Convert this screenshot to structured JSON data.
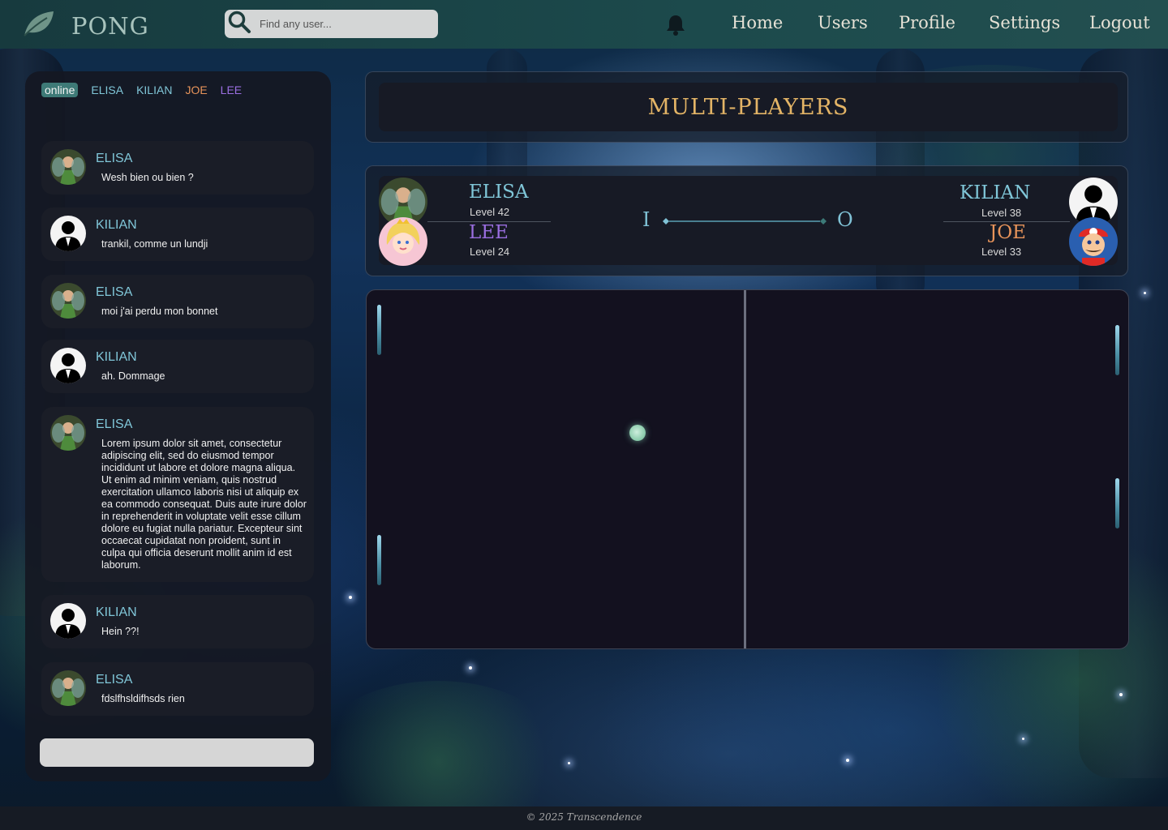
{
  "brand": {
    "name": "PONG"
  },
  "search": {
    "placeholder": "Find any user..."
  },
  "nav": {
    "home": "Home",
    "users": "Users",
    "profile": "Profile",
    "settings": "Settings",
    "logout": "Logout"
  },
  "online": {
    "label": "online",
    "users": [
      {
        "name": "ELISA",
        "color": "#80c6d8"
      },
      {
        "name": "KILIAN",
        "color": "#80c6d8"
      },
      {
        "name": "JOE",
        "color": "#e8945a"
      },
      {
        "name": "LEE",
        "color": "#9a6ee0"
      }
    ]
  },
  "chat": {
    "messages": [
      {
        "author": "ELISA",
        "avatar": "fairy-avatar",
        "text": "Wesh bien ou bien ?"
      },
      {
        "author": "KILIAN",
        "avatar": "silhouette-avatar",
        "text": "trankil, comme un lundji"
      },
      {
        "author": "ELISA",
        "avatar": "fairy-avatar",
        "text": "moi j'ai perdu mon bonnet"
      },
      {
        "author": "KILIAN",
        "avatar": "silhouette-avatar",
        "text": "ah. Dommage"
      },
      {
        "author": "ELISA",
        "avatar": "fairy-avatar",
        "text": "Lorem ipsum dolor sit amet, consectetur adipiscing elit, sed do eiusmod tempor incididunt ut labore et dolore magna aliqua. Ut enim ad minim veniam, quis nostrud exercitation ullamco laboris nisi ut aliquip ex ea commodo consequat. Duis aute irure dolor in reprehenderit in voluptate velit esse cillum dolore eu fugiat nulla pariatur. Excepteur sint occaecat cupidatat non proident, sunt in culpa qui officia deserunt mollit anim id est laborum."
      },
      {
        "author": "KILIAN",
        "avatar": "silhouette-avatar",
        "text": "Hein ??!"
      },
      {
        "author": "ELISA",
        "avatar": "fairy-avatar",
        "text": "fdslfhsldifhsds rien"
      }
    ],
    "input_value": ""
  },
  "game": {
    "title": "MULTI-PLAYERS",
    "left_team": [
      {
        "name": "ELISA",
        "level": "Level 42",
        "color": "#80c6d8",
        "avatar": "fairy-avatar"
      },
      {
        "name": "LEE",
        "level": "Level 24",
        "color": "#9a6ee0",
        "avatar": "princess-avatar"
      }
    ],
    "right_team": [
      {
        "name": "KILIAN",
        "level": "Level 38",
        "color": "#80c6d8",
        "avatar": "silhouette-avatar"
      },
      {
        "name": "JOE",
        "level": "Level 33",
        "color": "#e8945a",
        "avatar": "plumber-avatar"
      }
    ],
    "score_left": "I",
    "score_right": "O"
  },
  "footer": {
    "text": "© 2025 Transcendence"
  }
}
